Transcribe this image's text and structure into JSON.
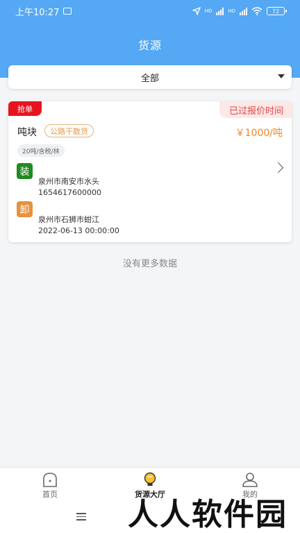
{
  "status_bar": {
    "time": "上午10:27",
    "network_labels": [
      "HD",
      "HD"
    ],
    "battery": "72"
  },
  "header": {
    "title": "货源"
  },
  "filter": {
    "selected": "全部"
  },
  "card": {
    "grab_tag": "抢单",
    "quote_status": "已过报价时间",
    "cargo_name": "吨块",
    "cargo_type": "公路干散货",
    "price": "￥1000/吨",
    "weight_tag": "20吨/含税/林",
    "load_label": "装",
    "load_address": "泉州市南安市水头",
    "load_time": "1654617600000",
    "unload_label": "卸",
    "unload_address": "泉州市石狮市蚶江",
    "unload_time": "2022-06-13 00:00:00"
  },
  "list_footer": "没有更多数据",
  "tabbar": {
    "items": [
      {
        "label": "首页",
        "icon": "home-icon"
      },
      {
        "label": "货源大厅",
        "icon": "bulb-icon"
      },
      {
        "label": "我的",
        "icon": "user-icon"
      }
    ]
  },
  "watermark": "人人软件园",
  "colors": {
    "header": "#55a8f3",
    "grab_tag": "#e7141f",
    "price": "#f0862c",
    "load": "#1f8a1f",
    "unload": "#e8913d"
  }
}
